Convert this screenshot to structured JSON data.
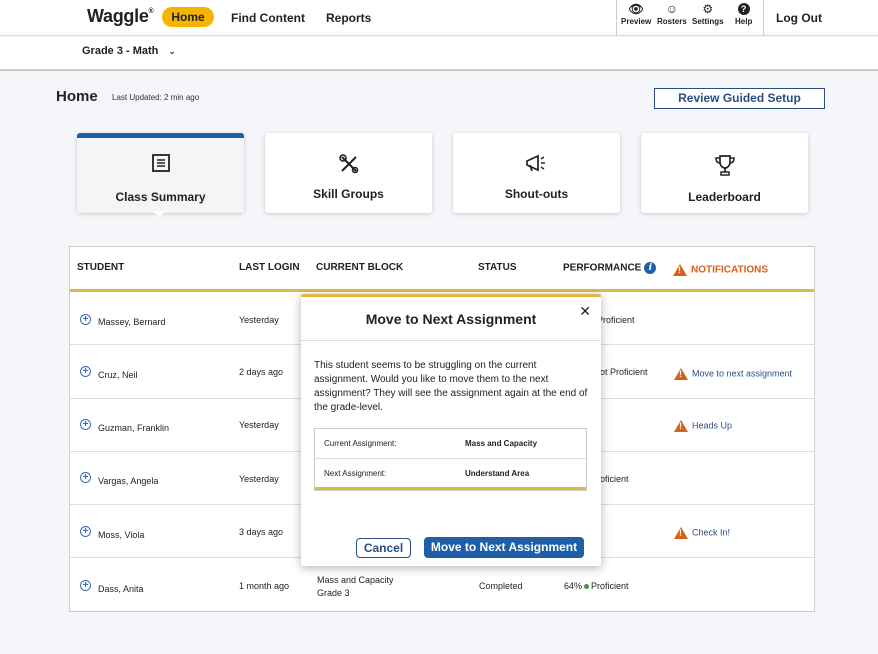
{
  "nav": {
    "logo": "Waggle",
    "logo_mark": "®",
    "home": "Home",
    "find_content": "Find Content",
    "reports": "Reports",
    "icons": [
      {
        "label": "Preview",
        "icon": "eye-icon",
        "glyph": "👁"
      },
      {
        "label": "Rosters",
        "icon": "face-icon",
        "glyph": "☺"
      },
      {
        "label": "Settings",
        "icon": "gear-icon",
        "glyph": "⚙"
      },
      {
        "label": "Help",
        "icon": "help-icon",
        "glyph": "?"
      }
    ],
    "logout": "Log Out"
  },
  "subnav": {
    "grade": "Grade 3 - Math",
    "chevron": "⌄"
  },
  "header": {
    "title": "Home",
    "last_updated": "Last Updated: 2 min ago",
    "guided_setup": "Review Guided Setup"
  },
  "cards": [
    {
      "label": "Class Summary",
      "icon": "list-icon",
      "glyph": "☰"
    },
    {
      "label": "Skill Groups",
      "icon": "tools-icon",
      "glyph": "✂"
    },
    {
      "label": "Shout-outs",
      "icon": "megaphone-icon",
      "glyph": "📣"
    },
    {
      "label": "Leaderboard",
      "icon": "trophy-icon",
      "glyph": "🏆"
    }
  ],
  "table": {
    "headers": {
      "student": "STUDENT",
      "last_login": "LAST LOGIN",
      "current_block": "CURRENT BLOCK",
      "status": "STATUS",
      "performance": "PERFORMANCE",
      "notifications": "NOTIFICATIONS"
    },
    "rows": [
      {
        "name": "Massey, Bernard",
        "login": "Yesterday",
        "perf": "Proficient",
        "notif": ""
      },
      {
        "name": "Cruz, Neil",
        "login": "2 days ago",
        "perf": "ot Proficient",
        "notif": "Move to next assignment"
      },
      {
        "name": "Guzman, Franklin",
        "login": "Yesterday",
        "perf": "",
        "notif": "Heads Up"
      },
      {
        "name": "Vargas, Angela",
        "login": "Yesterday",
        "perf": "oficient",
        "notif": ""
      },
      {
        "name": "Moss, Viola",
        "login": "3 days ago",
        "perf": "",
        "notif": "Check In!"
      },
      {
        "name": "Dass, Anita",
        "login": "1 month ago",
        "block": "Mass and Capacity",
        "block_sub": "Grade 3",
        "status": "Completed",
        "perf_pct": "64%",
        "perf": "Proficient",
        "notif": ""
      }
    ]
  },
  "modal": {
    "title": "Move to Next Assignment",
    "close": "✕",
    "text": "This student seems to be struggling on the current assignment. Would you like to move them to the next assignment? They will see the assignment again at the end of the grade-level.",
    "current_label": "Current Assignment:",
    "current_value": "Mass and Capacity",
    "next_label": "Next Assignment:",
    "next_value": "Understand Area",
    "cancel": "Cancel",
    "confirm": "Move to Next Assignment"
  },
  "colors": {
    "accent": "#f4b400",
    "primary": "#1f5fa8",
    "warning": "#d9601a",
    "gold_line": "#e0b94a"
  }
}
